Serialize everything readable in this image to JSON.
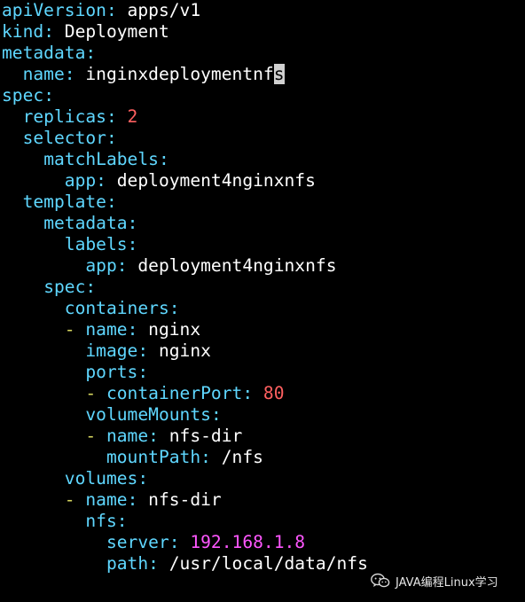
{
  "editor": {
    "lines": [
      {
        "indent": "",
        "key": "apiVersion",
        "sep": ":",
        "value": " apps/v1",
        "value_type": "str"
      },
      {
        "indent": "",
        "key": "kind",
        "sep": ":",
        "value": " Deployment",
        "value_type": "str"
      },
      {
        "indent": "",
        "key": "metadata",
        "sep": ":",
        "value": "",
        "value_type": "str"
      },
      {
        "indent": "  ",
        "key": "name",
        "sep": ":",
        "value": " inginxdeploymentnf",
        "cursor_char": "s",
        "value_type": "str"
      },
      {
        "indent": "",
        "key": "spec",
        "sep": ":",
        "value": "",
        "value_type": "str"
      },
      {
        "indent": "  ",
        "key": "replicas",
        "sep": ":",
        "value": " 2",
        "value_type": "num"
      },
      {
        "indent": "  ",
        "key": "selector",
        "sep": ":",
        "value": "",
        "value_type": "str"
      },
      {
        "indent": "    ",
        "key": "matchLabels",
        "sep": ":",
        "value": "",
        "value_type": "str"
      },
      {
        "indent": "      ",
        "key": "app",
        "sep": ":",
        "value": " deployment4nginxnfs",
        "value_type": "str"
      },
      {
        "indent": "  ",
        "key": "template",
        "sep": ":",
        "value": "",
        "value_type": "str"
      },
      {
        "indent": "    ",
        "key": "metadata",
        "sep": ":",
        "value": "",
        "value_type": "str"
      },
      {
        "indent": "      ",
        "key": "labels",
        "sep": ":",
        "value": "",
        "value_type": "str"
      },
      {
        "indent": "        ",
        "key": "app",
        "sep": ":",
        "value": " deployment4nginxnfs",
        "value_type": "str"
      },
      {
        "indent": "    ",
        "key": "spec",
        "sep": ":",
        "value": "",
        "value_type": "str"
      },
      {
        "indent": "      ",
        "key": "containers",
        "sep": ":",
        "value": "",
        "value_type": "str"
      },
      {
        "indent": "      ",
        "dash": "- ",
        "key": "name",
        "sep": ":",
        "value": " nginx",
        "value_type": "str"
      },
      {
        "indent": "        ",
        "key": "image",
        "sep": ":",
        "value": " nginx",
        "value_type": "str"
      },
      {
        "indent": "        ",
        "key": "ports",
        "sep": ":",
        "value": "",
        "value_type": "str"
      },
      {
        "indent": "        ",
        "dash": "- ",
        "key": "containerPort",
        "sep": ":",
        "value": " 80",
        "value_type": "num"
      },
      {
        "indent": "        ",
        "key": "volumeMounts",
        "sep": ":",
        "value": "",
        "value_type": "str"
      },
      {
        "indent": "        ",
        "dash": "- ",
        "key": "name",
        "sep": ":",
        "value": " nfs-dir",
        "value_type": "str"
      },
      {
        "indent": "          ",
        "key": "mountPath",
        "sep": ":",
        "value": " /nfs",
        "value_type": "str"
      },
      {
        "indent": "      ",
        "key": "volumes",
        "sep": ":",
        "value": "",
        "value_type": "str"
      },
      {
        "indent": "      ",
        "dash": "- ",
        "key": "name",
        "sep": ":",
        "value": " nfs-dir",
        "value_type": "str"
      },
      {
        "indent": "        ",
        "key": "nfs",
        "sep": ":",
        "value": "",
        "value_type": "str"
      },
      {
        "indent": "          ",
        "key": "server",
        "sep": ":",
        "value": " 192.168.1.8",
        "value_type": "ip"
      },
      {
        "indent": "          ",
        "key": "path",
        "sep": ":",
        "value": " /usr/local/data/nfs",
        "value_type": "str"
      }
    ]
  },
  "watermark": {
    "text": "JAVA编程Linux学习",
    "icon": "wechat-icon"
  },
  "colors": {
    "background": "#000000",
    "key": "#5fd7ff",
    "dash": "#d7d75f",
    "number": "#ff6060",
    "ip": "#ff57ff",
    "text": "#ffffff",
    "cursor": "#d0d0d0"
  }
}
